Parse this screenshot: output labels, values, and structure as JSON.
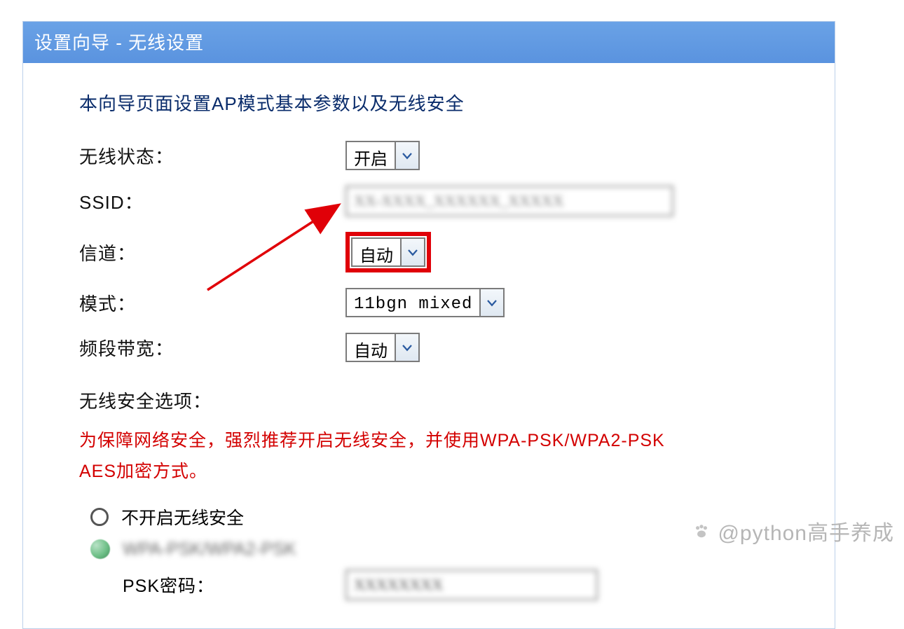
{
  "header": {
    "title": "设置向导 - 无线设置"
  },
  "intro": "本向导页面设置AP模式基本参数以及无线安全",
  "fields": {
    "wireless_status": {
      "label": "无线状态：",
      "value": "开启"
    },
    "ssid": {
      "label": "SSID：",
      "value": "XX-XXXX_XXXXXX_XXXXX"
    },
    "channel": {
      "label": "信道：",
      "value": "自动"
    },
    "mode": {
      "label": "模式：",
      "value": "11bgn mixed"
    },
    "bandwidth": {
      "label": "频段带宽：",
      "value": "自动"
    }
  },
  "security": {
    "section_label": "无线安全选项：",
    "warning": "为保障网络安全，强烈推荐开启无线安全，并使用WPA-PSK/WPA2-PSK AES加密方式。",
    "option_disabled_label": "不开启无线安全",
    "option_wpa_label": "WPA-PSK/WPA2-PSK",
    "psk_label": "PSK密码：",
    "psk_value": "XXXXXXXX"
  },
  "watermark": {
    "text": "@python高手养成"
  }
}
